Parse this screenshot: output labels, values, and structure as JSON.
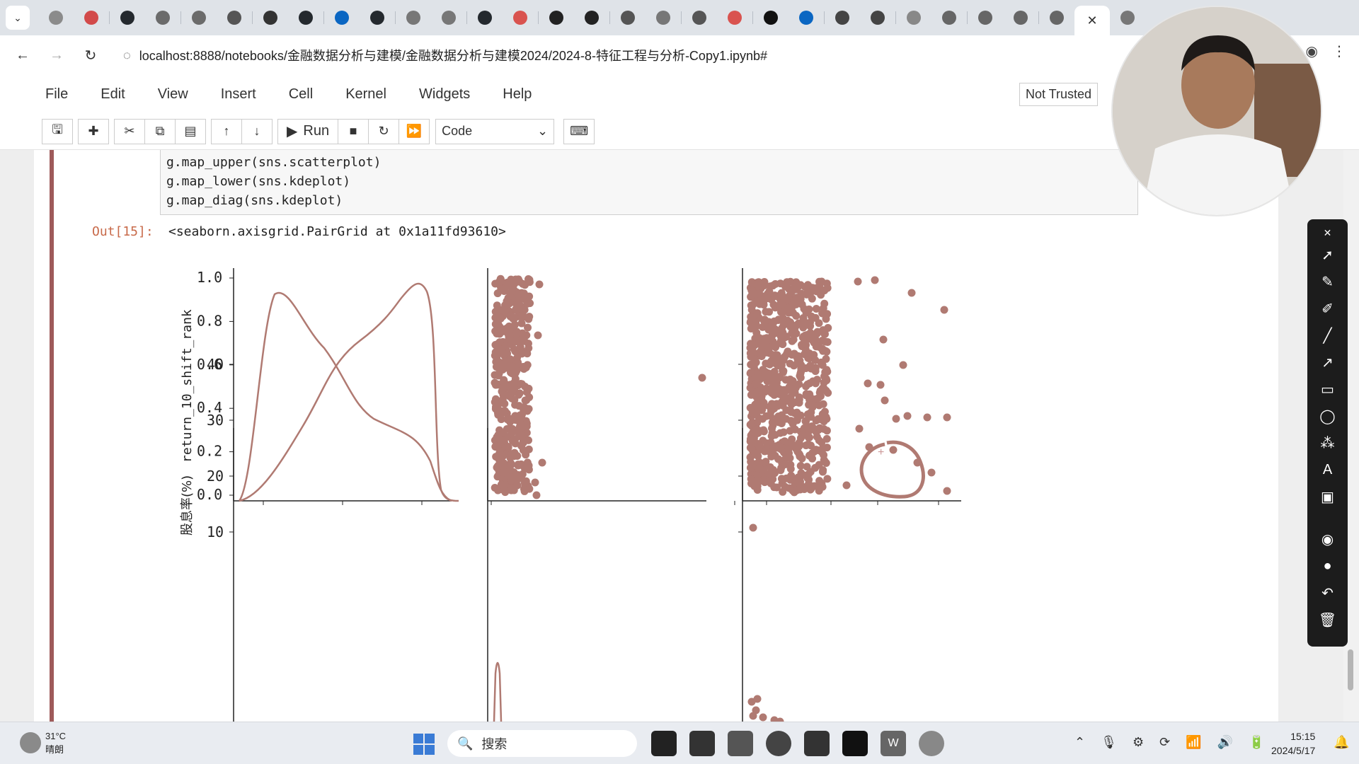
{
  "browser": {
    "tabs": [
      {
        "icon": "app-icon",
        "color": "#8b8b8b"
      },
      {
        "icon": "red-record-icon",
        "color": "#d24a4a"
      },
      {
        "icon": "github-icon",
        "color": "#24292e"
      },
      {
        "icon": "translate-icon",
        "color": "#6b6b6b"
      },
      {
        "icon": "translate-icon",
        "color": "#6b6b6b"
      },
      {
        "icon": "globe-icon",
        "color": "#555"
      },
      {
        "icon": "video-icon",
        "color": "#333"
      },
      {
        "icon": "github-icon",
        "color": "#24292e"
      },
      {
        "icon": "zhihu-icon",
        "color": "#0a66c2"
      },
      {
        "icon": "github-icon",
        "color": "#24292e"
      },
      {
        "icon": "cloud-icon",
        "color": "#777"
      },
      {
        "icon": "cloud-icon",
        "color": "#777"
      },
      {
        "icon": "github-icon",
        "color": "#24292e"
      },
      {
        "icon": "c-icon",
        "color": "#d9534f"
      },
      {
        "icon": "game-icon",
        "color": "#222"
      },
      {
        "icon": "crown-icon",
        "color": "#222"
      },
      {
        "icon": "globe-icon",
        "color": "#555"
      },
      {
        "icon": "feather-icon",
        "color": "#777"
      },
      {
        "icon": "user-icon",
        "color": "#555"
      },
      {
        "icon": "c-icon",
        "color": "#d9534f"
      },
      {
        "icon": "medium-icon",
        "color": "#111"
      },
      {
        "icon": "zhihu-icon",
        "color": "#0a66c2"
      },
      {
        "icon": "sphere-icon",
        "color": "#444"
      },
      {
        "icon": "sphere-icon",
        "color": "#444"
      },
      {
        "icon": "loading-icon",
        "color": "#888"
      },
      {
        "icon": "page-icon",
        "color": "#666"
      },
      {
        "icon": "page-icon",
        "color": "#666"
      },
      {
        "icon": "page-icon",
        "color": "#666"
      },
      {
        "icon": "page-icon",
        "color": "#666"
      }
    ],
    "url": "localhost:8888/notebooks/金融数据分析与建模/金融数据分析与建模2024/2024-8-特征工程与分析-Copy1.ipynb#"
  },
  "jupyter": {
    "menu": [
      "File",
      "Edit",
      "View",
      "Insert",
      "Cell",
      "Kernel",
      "Widgets",
      "Help"
    ],
    "trusted_label": "Not Trusted",
    "toolbar": {
      "run_label": "Run",
      "cell_type": "Code"
    },
    "code_lines": [
      "g.map_upper(sns.scatterplot)",
      "g.map_lower(sns.kdeplot)",
      "g.map_diag(sns.kdeplot)"
    ],
    "output_prompt": "Out[15]:",
    "output_text": "<seaborn.axisgrid.PairGrid at 0x1a11fd93610>"
  },
  "chart_data": {
    "type": "scatter",
    "title": "",
    "ylabels": [
      "return_10_shift_rank",
      "股息率(%)"
    ],
    "row1_yticks": [
      "0.0",
      "0.2",
      "0.4",
      "0.6",
      "0.8",
      "1.0"
    ],
    "row2_yticks": [
      "10",
      "20",
      "30",
      "40"
    ],
    "diagonal_kde": "two density curves crossing near y=0.6",
    "scatter_color": "#b07a72",
    "annotation": "hand-drawn circle highlighting outliers"
  },
  "taskbar": {
    "weather_temp": "31°C",
    "weather_desc": "晴朗",
    "search_placeholder": "搜索",
    "time": "15:15",
    "date": "2024/5/17"
  },
  "colors": {
    "cell_bar": "#9e5a5a",
    "plot_marker": "#b07a72",
    "plot_line": "#b07a72"
  }
}
